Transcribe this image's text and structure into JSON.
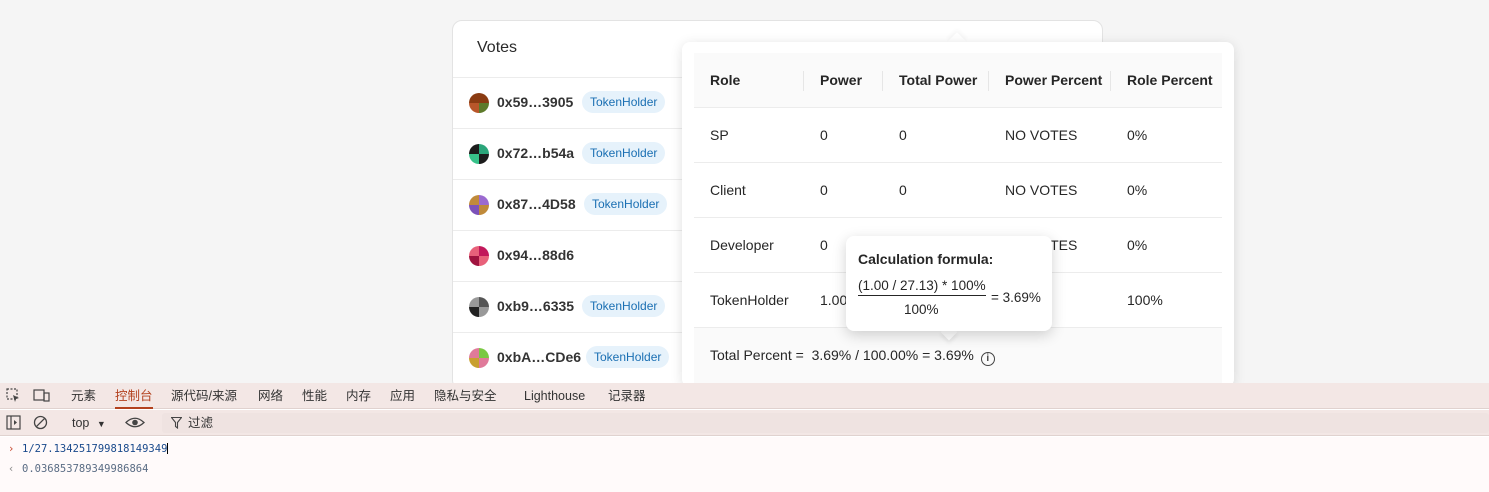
{
  "votes": {
    "title": "Votes",
    "voters": [
      {
        "address": "0x59…3905",
        "role": "TokenHolder",
        "avatar_colors": [
          "#8a3b12",
          "#5d7a2a",
          "#b8562a"
        ]
      },
      {
        "address": "0x72…b54a",
        "role": "TokenHolder",
        "avatar_colors": [
          "#2aa57a",
          "#1c1c1c",
          "#38c28a"
        ]
      },
      {
        "address": "0x87…4D58",
        "role": "TokenHolder",
        "avatar_colors": [
          "#9b6ad0",
          "#c08a3a",
          "#7c52b8"
        ]
      },
      {
        "address": "0x94…88d6",
        "role": "",
        "avatar_colors": [
          "#c2185b",
          "#e8617a",
          "#a0143f"
        ]
      },
      {
        "address": "0xb9…6335",
        "role": "TokenHolder",
        "avatar_colors": [
          "#555",
          "#999",
          "#222"
        ]
      },
      {
        "address": "0xbA…CDe6",
        "role": "TokenHolder",
        "avatar_colors": [
          "#7ac943",
          "#e07a9a",
          "#c8a030"
        ]
      }
    ]
  },
  "popover": {
    "headers": [
      "Role",
      "Power",
      "Total Power",
      "Power Percent",
      "Role Percent"
    ],
    "rows": [
      [
        "SP",
        "0",
        "0",
        "NO VOTES",
        "0%"
      ],
      [
        "Client",
        "0",
        "0",
        "NO VOTES",
        "0%"
      ],
      [
        "Developer",
        "0",
        "",
        "NO VOTES",
        "0%"
      ],
      [
        "TokenHolder",
        "1.00",
        "",
        "",
        "100%"
      ]
    ],
    "total_label": "Total Percent =",
    "total_formula": "3.69% / 100.00% = 3.69%",
    "info_glyph": "i"
  },
  "tooltip": {
    "title": "Calculation formula:",
    "numerator": "(1.00 / 27.13) * 100%",
    "denominator": "100%",
    "result": "= 3.69%"
  },
  "devtools": {
    "tabs": [
      "元素",
      "控制台",
      "源代码/来源",
      "网络",
      "性能",
      "内存",
      "应用",
      "隐私与安全",
      "Lighthouse",
      "记录器"
    ],
    "active_tab": "控制台",
    "context": "top",
    "filter_label": "过滤",
    "console_input": "1/27.134251799818149349",
    "console_output": "0.036853789349986864"
  },
  "colors": {
    "accent": "#b3411e",
    "badge_bg": "#e6f2fb",
    "badge_text": "#1a6fb3"
  }
}
